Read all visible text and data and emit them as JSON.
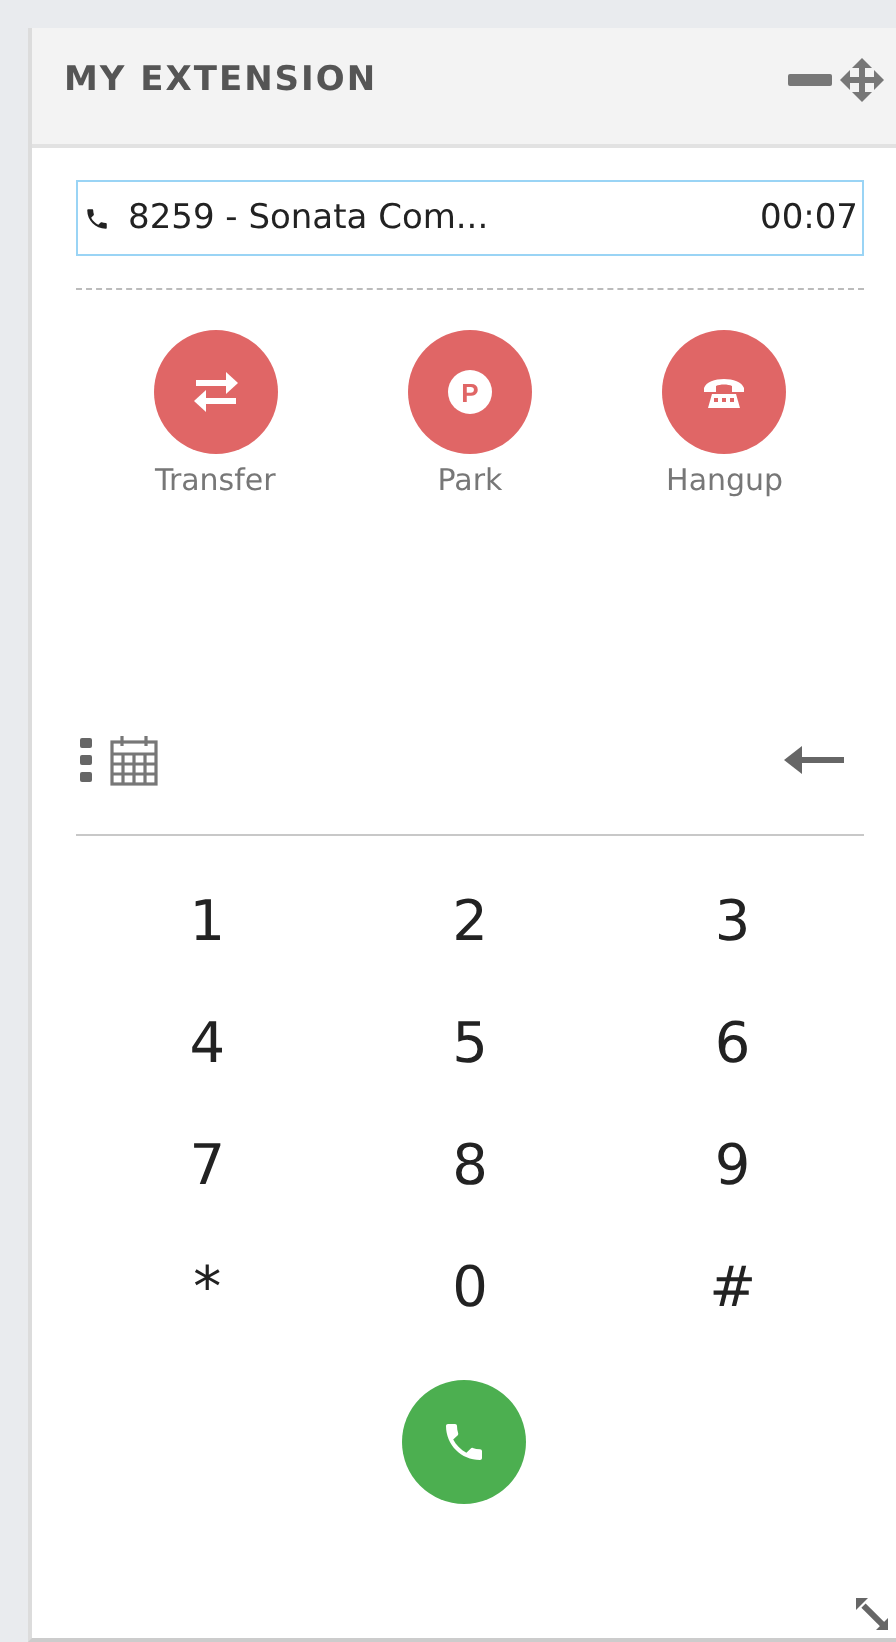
{
  "panel": {
    "title": "MY EXTENSION"
  },
  "call": {
    "label": "8259 - Sonata Com...",
    "time": "00:07"
  },
  "actions": [
    {
      "kind": "transfer",
      "label": "Transfer"
    },
    {
      "kind": "park",
      "label": "Park",
      "glyph": "P"
    },
    {
      "kind": "hangup",
      "label": "Hangup"
    }
  ],
  "keypad": [
    "1",
    "2",
    "3",
    "4",
    "5",
    "6",
    "7",
    "8",
    "9",
    "*",
    "0",
    "#"
  ]
}
